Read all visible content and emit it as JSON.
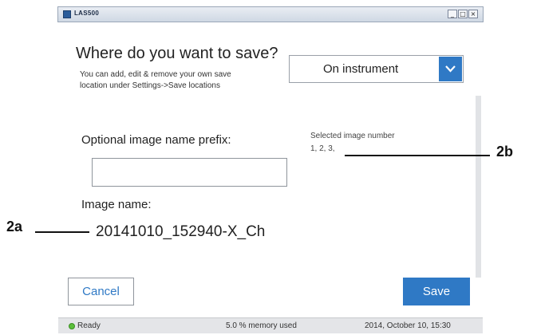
{
  "window": {
    "title": "LAS500",
    "min_label": "_",
    "max_label": "□",
    "close_label": "×"
  },
  "header": {
    "title": "Where do you want to save?",
    "desc_line1": "You can add, edit & remove your own save",
    "desc_line2": "location under Settings->Save locations"
  },
  "location_select": {
    "value": "On instrument"
  },
  "prefix": {
    "label": "Optional image name prefix:",
    "value": ""
  },
  "selection": {
    "label": "Selected image number",
    "value": "1, 2, 3,"
  },
  "image_name": {
    "label": "Image name:",
    "value": "20141010_152940-X_Ch"
  },
  "callouts": {
    "a": "2a",
    "b": "2b"
  },
  "buttons": {
    "cancel": "Cancel",
    "save": "Save"
  },
  "status": {
    "ready": "Ready",
    "memory": "5.0 % memory used",
    "datetime": "2014, October 10, 15:30"
  },
  "colors": {
    "accent": "#2f79c5",
    "status_ok": "#5bbf3b"
  }
}
